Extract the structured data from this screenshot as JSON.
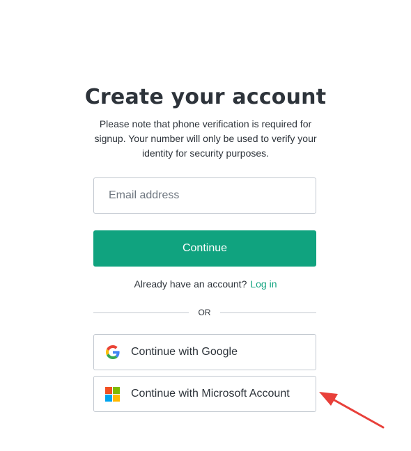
{
  "header": {
    "title": "Create your account",
    "subtitle": "Please note that phone verification is required for signup. Your number will only be used to verify your identity for security purposes."
  },
  "form": {
    "email_placeholder": "Email address",
    "email_value": "",
    "continue_label": "Continue"
  },
  "login": {
    "prompt": "Already have an account?",
    "link_label": "Log in"
  },
  "divider": {
    "label": "OR"
  },
  "social": {
    "google_label": "Continue with Google",
    "google_icon": "google-icon",
    "microsoft_label": "Continue with Microsoft Account",
    "microsoft_icon": "microsoft-icon"
  },
  "colors": {
    "accent": "#10a37f",
    "border": "#c2c8d0",
    "text": "#2d333a",
    "annotation_arrow": "#e8403a"
  }
}
